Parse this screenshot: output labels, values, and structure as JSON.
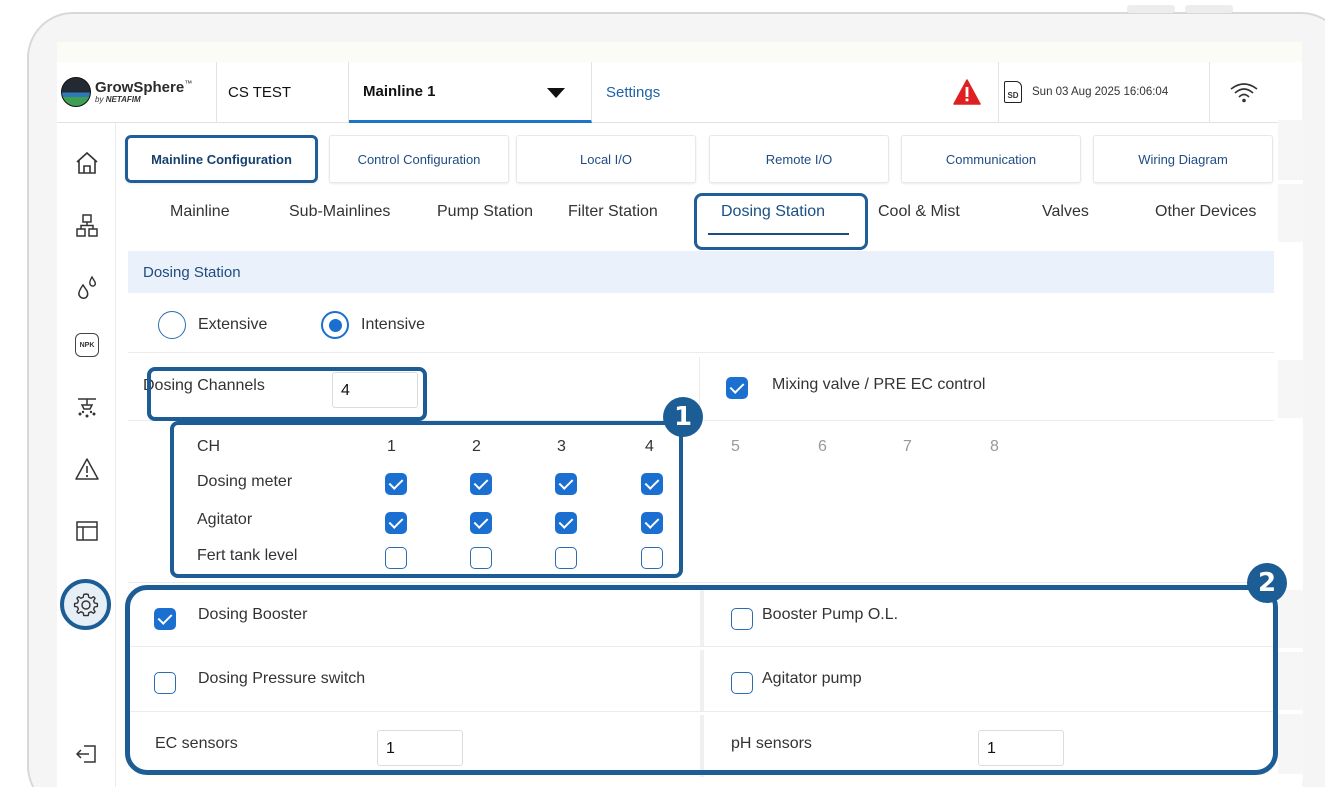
{
  "app": {
    "brand": "GrowSphere",
    "brand_tm": "™",
    "brand_by": "by",
    "brand_company": "NETAFIM"
  },
  "header": {
    "site": "CS TEST",
    "mainline_selector": "Mainline 1",
    "settings_link": "Settings",
    "sd_label": "SD",
    "datetime": "Sun 03 Aug 2025  16:06:04",
    "alert_color": "#e02020"
  },
  "tabs_primary": [
    {
      "label": "Mainline Configuration",
      "active": true
    },
    {
      "label": "Control Configuration",
      "active": false
    },
    {
      "label": "Local I/O",
      "active": false
    },
    {
      "label": "Remote  I/O",
      "active": false
    },
    {
      "label": "Communication",
      "active": false
    },
    {
      "label": "Wiring Diagram",
      "active": false
    }
  ],
  "tabs_secondary": [
    {
      "label": "Mainline",
      "active": false
    },
    {
      "label": "Sub-Mainlines",
      "active": false
    },
    {
      "label": "Pump Station",
      "active": false
    },
    {
      "label": "Filter Station",
      "active": false
    },
    {
      "label": "Dosing Station",
      "active": true
    },
    {
      "label": "Cool & Mist",
      "active": false
    },
    {
      "label": "Valves",
      "active": false
    },
    {
      "label": "Other Devices",
      "active": false
    }
  ],
  "section": {
    "title": "Dosing Station",
    "mode_options": [
      {
        "label": "Extensive",
        "selected": false
      },
      {
        "label": "Intensive",
        "selected": true
      }
    ],
    "dosing_channels_label": "Dosing Channels",
    "dosing_channels_value": "4",
    "mixing_valve_label": "Mixing valve / PRE EC control",
    "mixing_valve_checked": true,
    "channel_grid": {
      "header_label": "CH",
      "channels": [
        "1",
        "2",
        "3",
        "4",
        "5",
        "6",
        "7",
        "8"
      ],
      "rows": [
        {
          "label": "Dosing meter",
          "values": [
            true,
            true,
            true,
            true
          ]
        },
        {
          "label": "Agitator",
          "values": [
            true,
            true,
            true,
            true
          ]
        },
        {
          "label": "Fert tank level",
          "values": [
            false,
            false,
            false,
            false
          ]
        }
      ]
    },
    "options": {
      "dosing_booster": {
        "label": "Dosing Booster",
        "checked": true
      },
      "booster_pump_ol": {
        "label": "Booster Pump O.L.",
        "checked": false
      },
      "dosing_pressure_switch": {
        "label": "Dosing Pressure switch",
        "checked": false
      },
      "agitator_pump": {
        "label": "Agitator pump",
        "checked": false
      },
      "ec_sensors": {
        "label": "EC sensors",
        "value": "1"
      },
      "ph_sensors": {
        "label": "pH sensors",
        "value": "1"
      }
    }
  },
  "annotations": {
    "badge_1": "1",
    "badge_2": "2",
    "color": "#1c5d96"
  }
}
